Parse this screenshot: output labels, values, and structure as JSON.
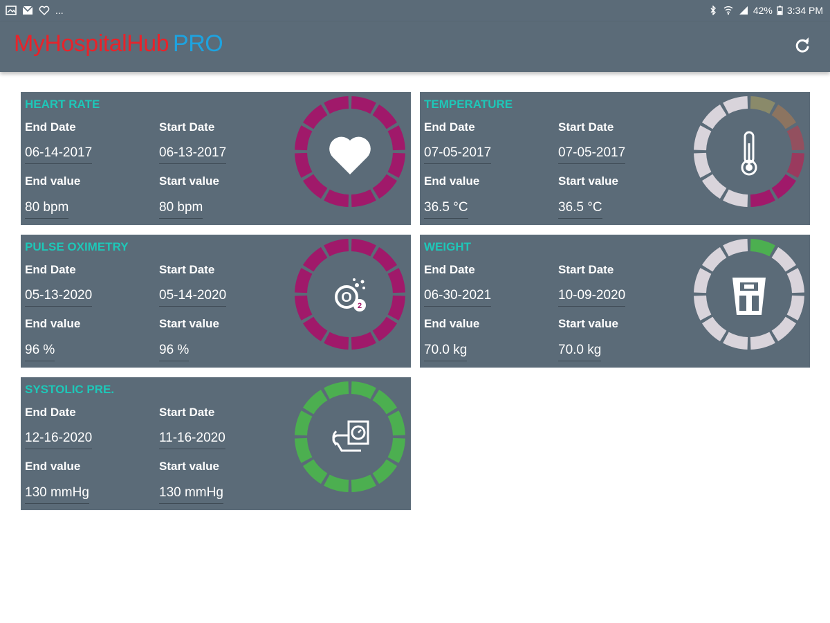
{
  "statusbar": {
    "dots": "...",
    "battery": "42%",
    "time": "3:34 PM"
  },
  "app": {
    "title_main": "MyHospitalHub",
    "title_pro": "PRO"
  },
  "colors": {
    "bar": "#5b6b78",
    "teal": "#1ec7b8",
    "magenta": "#a0196a",
    "green": "#4caf50",
    "grey_seg": "#d9d4db"
  },
  "labels": {
    "end_date": "End Date",
    "start_date": "Start Date",
    "end_value": "End value",
    "start_value": "Start value"
  },
  "cards": [
    {
      "title": "HEART RATE",
      "end_date": "06-14-2017",
      "start_date": "06-13-2017",
      "end_value": "80 bpm",
      "start_value": "80 bpm",
      "icon": "heart-icon"
    },
    {
      "title": "TEMPERATURE",
      "end_date": "07-05-2017",
      "start_date": "07-05-2017",
      "end_value": "36.5 °C",
      "start_value": "36.5 °C",
      "icon": "thermometer-icon"
    },
    {
      "title": "PULSE OXIMETRY",
      "end_date": "05-13-2020",
      "start_date": "05-14-2020",
      "end_value": "96 %",
      "start_value": "96 %",
      "icon": "oxygen-icon",
      "icon_text": "O",
      "icon_sub": "2"
    },
    {
      "title": "WEIGHT",
      "end_date": "06-30-2021",
      "start_date": "10-09-2020",
      "end_value": "70.0 kg",
      "start_value": "70.0 kg",
      "icon": "scale-icon"
    },
    {
      "title": "SYSTOLIC PRE.",
      "end_date": "12-16-2020",
      "start_date": "11-16-2020",
      "end_value": "130 mmHg",
      "start_value": "130 mmHg",
      "icon": "blood-pressure-icon"
    }
  ]
}
